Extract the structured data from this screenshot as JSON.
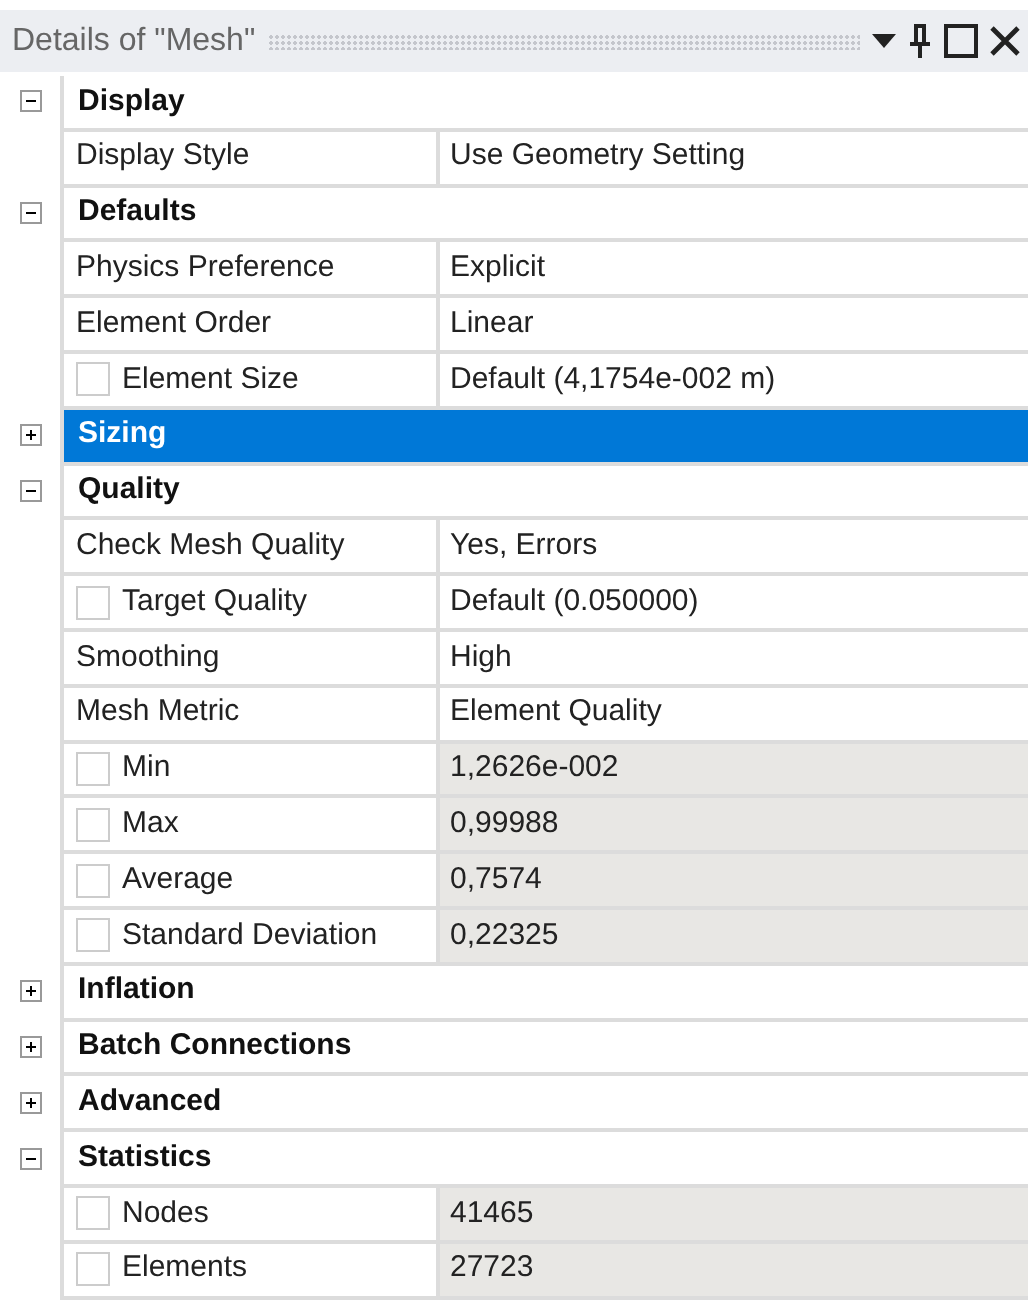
{
  "title": "Details of \"Mesh\"",
  "rows": [
    {
      "kind": "section",
      "label": "Display",
      "expanded": true,
      "selected": false
    },
    {
      "kind": "property",
      "label": "Display Style",
      "value": "Use Geometry Setting",
      "readonly": false
    },
    {
      "kind": "section",
      "label": "Defaults",
      "expanded": true,
      "selected": false
    },
    {
      "kind": "property",
      "label": "Physics Preference",
      "value": "Explicit",
      "readonly": false
    },
    {
      "kind": "property",
      "label": "Element Order",
      "value": "Linear",
      "readonly": false
    },
    {
      "kind": "property",
      "label": "Element Size",
      "value": "Default (4,1754e-002 m)",
      "readonly": false,
      "checked": false
    },
    {
      "kind": "section",
      "label": "Sizing",
      "expanded": false,
      "selected": true
    },
    {
      "kind": "section",
      "label": "Quality",
      "expanded": true,
      "selected": false
    },
    {
      "kind": "property",
      "label": "Check Mesh Quality",
      "value": "Yes, Errors",
      "readonly": false
    },
    {
      "kind": "property",
      "label": "Target Quality",
      "value": "Default (0.050000)",
      "readonly": false,
      "checked": false
    },
    {
      "kind": "property",
      "label": "Smoothing",
      "value": "High",
      "readonly": false
    },
    {
      "kind": "property",
      "label": "Mesh Metric",
      "value": "Element Quality",
      "readonly": false
    },
    {
      "kind": "property",
      "label": "Min",
      "value": "1,2626e-002",
      "readonly": true,
      "checked": false
    },
    {
      "kind": "property",
      "label": "Max",
      "value": "0,99988",
      "readonly": true,
      "checked": false
    },
    {
      "kind": "property",
      "label": "Average",
      "value": "0,7574",
      "readonly": true,
      "checked": false
    },
    {
      "kind": "property",
      "label": "Standard Deviation",
      "value": "0,22325",
      "readonly": true,
      "checked": false
    },
    {
      "kind": "section",
      "label": "Inflation",
      "expanded": false,
      "selected": false
    },
    {
      "kind": "section",
      "label": "Batch Connections",
      "expanded": false,
      "selected": false
    },
    {
      "kind": "section",
      "label": "Advanced",
      "expanded": false,
      "selected": false
    },
    {
      "kind": "section",
      "label": "Statistics",
      "expanded": true,
      "selected": false
    },
    {
      "kind": "property",
      "label": "Nodes",
      "value": "41465",
      "readonly": true,
      "checked": false
    },
    {
      "kind": "property",
      "label": "Elements",
      "value": "27723",
      "readonly": true,
      "checked": false
    }
  ]
}
